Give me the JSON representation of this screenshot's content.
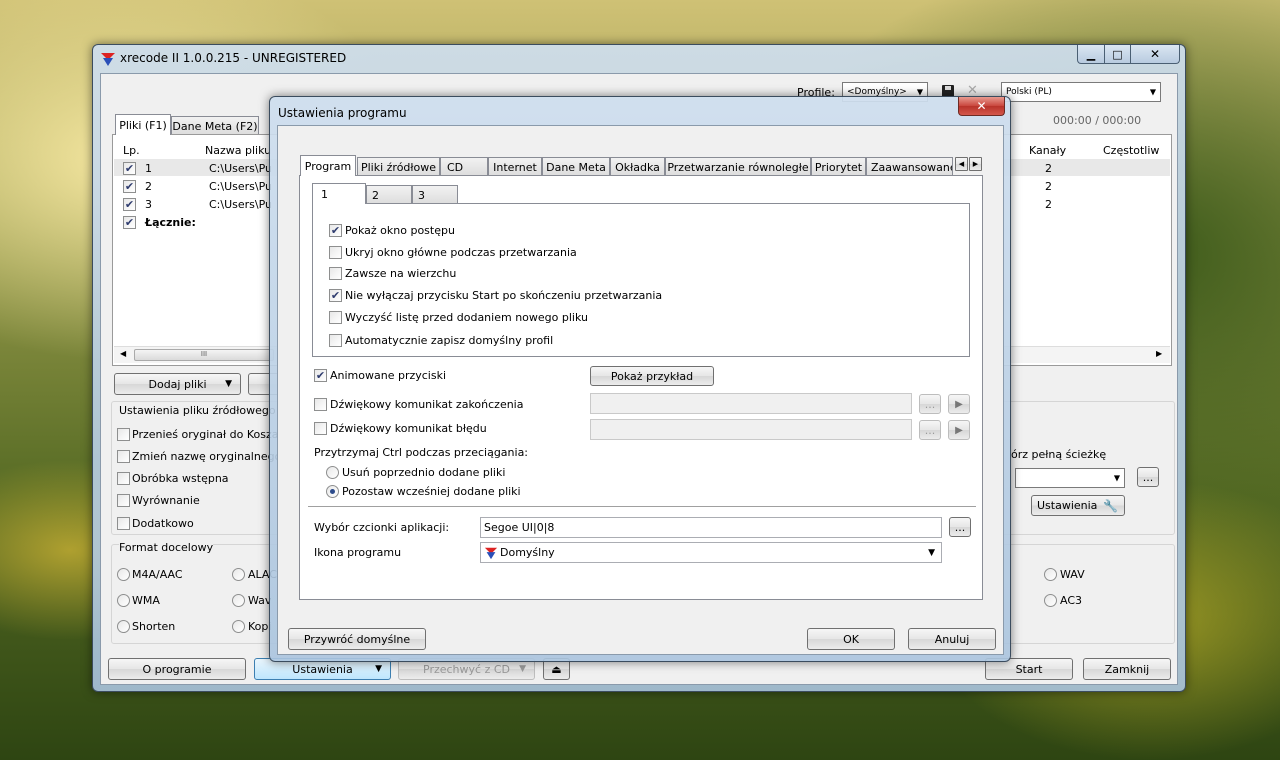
{
  "main_window": {
    "title": "xrecode II 1.0.0.215 - UNREGISTERED",
    "profile_label": "Profile:",
    "profile_value": "<Domyślny>",
    "language_value": "Polski (PL)",
    "time_display": "000:00 / 000:00",
    "tabs": [
      "Pliki (F1)",
      "Dane Meta (F2)"
    ],
    "file_table": {
      "columns": [
        "Lp.",
        "Nazwa pliku"
      ],
      "right_columns": [
        "Kanały",
        "Częstotliw"
      ],
      "rows": [
        {
          "num": "1",
          "path": "C:\\Users\\Pu",
          "channels": "2"
        },
        {
          "num": "2",
          "path": "C:\\Users\\Pu",
          "channels": "2"
        },
        {
          "num": "3",
          "path": "C:\\Users\\Pu",
          "channels": "2"
        }
      ],
      "total_label": "Łącznie:",
      "scroll_grip": "III"
    },
    "add_files_button": "Dodaj pliki",
    "source_settings_title": "Ustawienia pliku źródłowego",
    "source_options": [
      "Przenieś oryginał do Kosza",
      "Zmień nazwę oryginalnego",
      "Obróbka wstępna",
      "Wyrównanie",
      "Dodatkowo"
    ],
    "full_path_label": "órz pełną ścieżkę",
    "more_button": "...",
    "settings_button": "Ustawienia",
    "format_title": "Format docelowy",
    "formats_left": [
      "M4A/AAC",
      "WMA",
      "Shorten"
    ],
    "formats_mid": [
      "ALAC",
      "Wav",
      "Kopi"
    ],
    "formats_right": [
      "WAV",
      "AC3"
    ],
    "bottom_buttons": {
      "about": "O programie",
      "settings": "Ustawienia",
      "capture_cd": "Przechwyć z CD",
      "eject": "⏏",
      "start": "Start",
      "close": "Zamknij"
    }
  },
  "dialog": {
    "title": "Ustawienia programu",
    "tabs": [
      "Program",
      "Pliki źródłowe",
      "CD",
      "Internet",
      "Dane Meta",
      "Okładka",
      "Przetwarzanie równoległe",
      "Priorytet",
      "Zaawansowane"
    ],
    "subtabs": [
      "1",
      "2",
      "3"
    ],
    "checkboxes": [
      {
        "label": "Pokaż okno postępu",
        "checked": true
      },
      {
        "label": "Ukryj okno główne podczas przetwarzania",
        "checked": false
      },
      {
        "label": "Zawsze na wierzchu",
        "checked": false
      },
      {
        "label": "Nie wyłączaj przycisku Start po skończeniu przetwarzania",
        "checked": true
      },
      {
        "label": "Wyczyść listę przed dodaniem nowego pliku",
        "checked": false
      },
      {
        "label": "Automatycznie zapisz domyślny profil",
        "checked": false
      }
    ],
    "animated_buttons": {
      "label": "Animowane przyciski",
      "checked": true
    },
    "show_example_button": "Pokaż przykład",
    "sound_finish": {
      "label": "Dźwiękowy komunikat zakończenia",
      "checked": false
    },
    "sound_error": {
      "label": "Dźwiękowy komunikat błędu",
      "checked": false
    },
    "browse": "...",
    "ctrl_label": "Przytrzymaj Ctrl podczas przeciągania:",
    "radios": [
      {
        "label": "Usuń poprzednio dodane pliki",
        "selected": false
      },
      {
        "label": "Pozostaw wcześniej dodane pliki",
        "selected": true
      }
    ],
    "font_label": "Wybór czcionki aplikacji:",
    "font_value": "Segoe UI|0|8",
    "icon_label": "Ikona programu",
    "icon_value": "Domyślny",
    "restore_button": "Przywróć domyślne",
    "ok_button": "OK",
    "cancel_button": "Anuluj"
  },
  "colors": {
    "accent": "#3a6fb5",
    "close_red": "#c9463d"
  }
}
